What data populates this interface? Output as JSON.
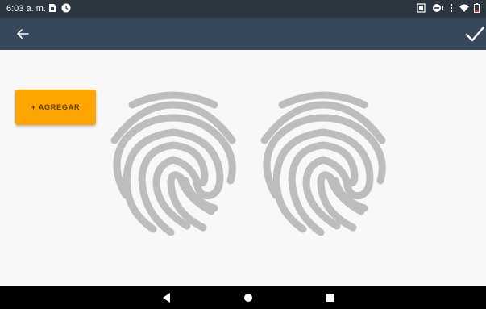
{
  "status_bar": {
    "time": "6:03 a. m.",
    "left_icons": [
      "sim-card-icon",
      "clock-alarm-icon"
    ],
    "right_icons": [
      "vibrate-icon",
      "do-not-disturb-icon",
      "signal-icon",
      "wifi-icon",
      "battery-low-icon"
    ]
  },
  "app_bar": {
    "back_icon": "arrow-back-icon",
    "confirm_icon": "check-icon"
  },
  "content": {
    "add_button_label": "+ AGREGAR",
    "fingerprints": [
      "fingerprint-icon",
      "fingerprint-icon"
    ]
  },
  "nav_bar": {
    "buttons": [
      "back-triangle-icon",
      "home-circle-icon",
      "recents-square-icon"
    ]
  },
  "colors": {
    "status_bar": "#2b3640",
    "app_bar": "#36495b",
    "accent_button": "#ffa500",
    "fingerprint": "#bdbdbd",
    "background": "#f8f8f8",
    "nav_bar": "#000000",
    "battery_low": "#e53935"
  }
}
